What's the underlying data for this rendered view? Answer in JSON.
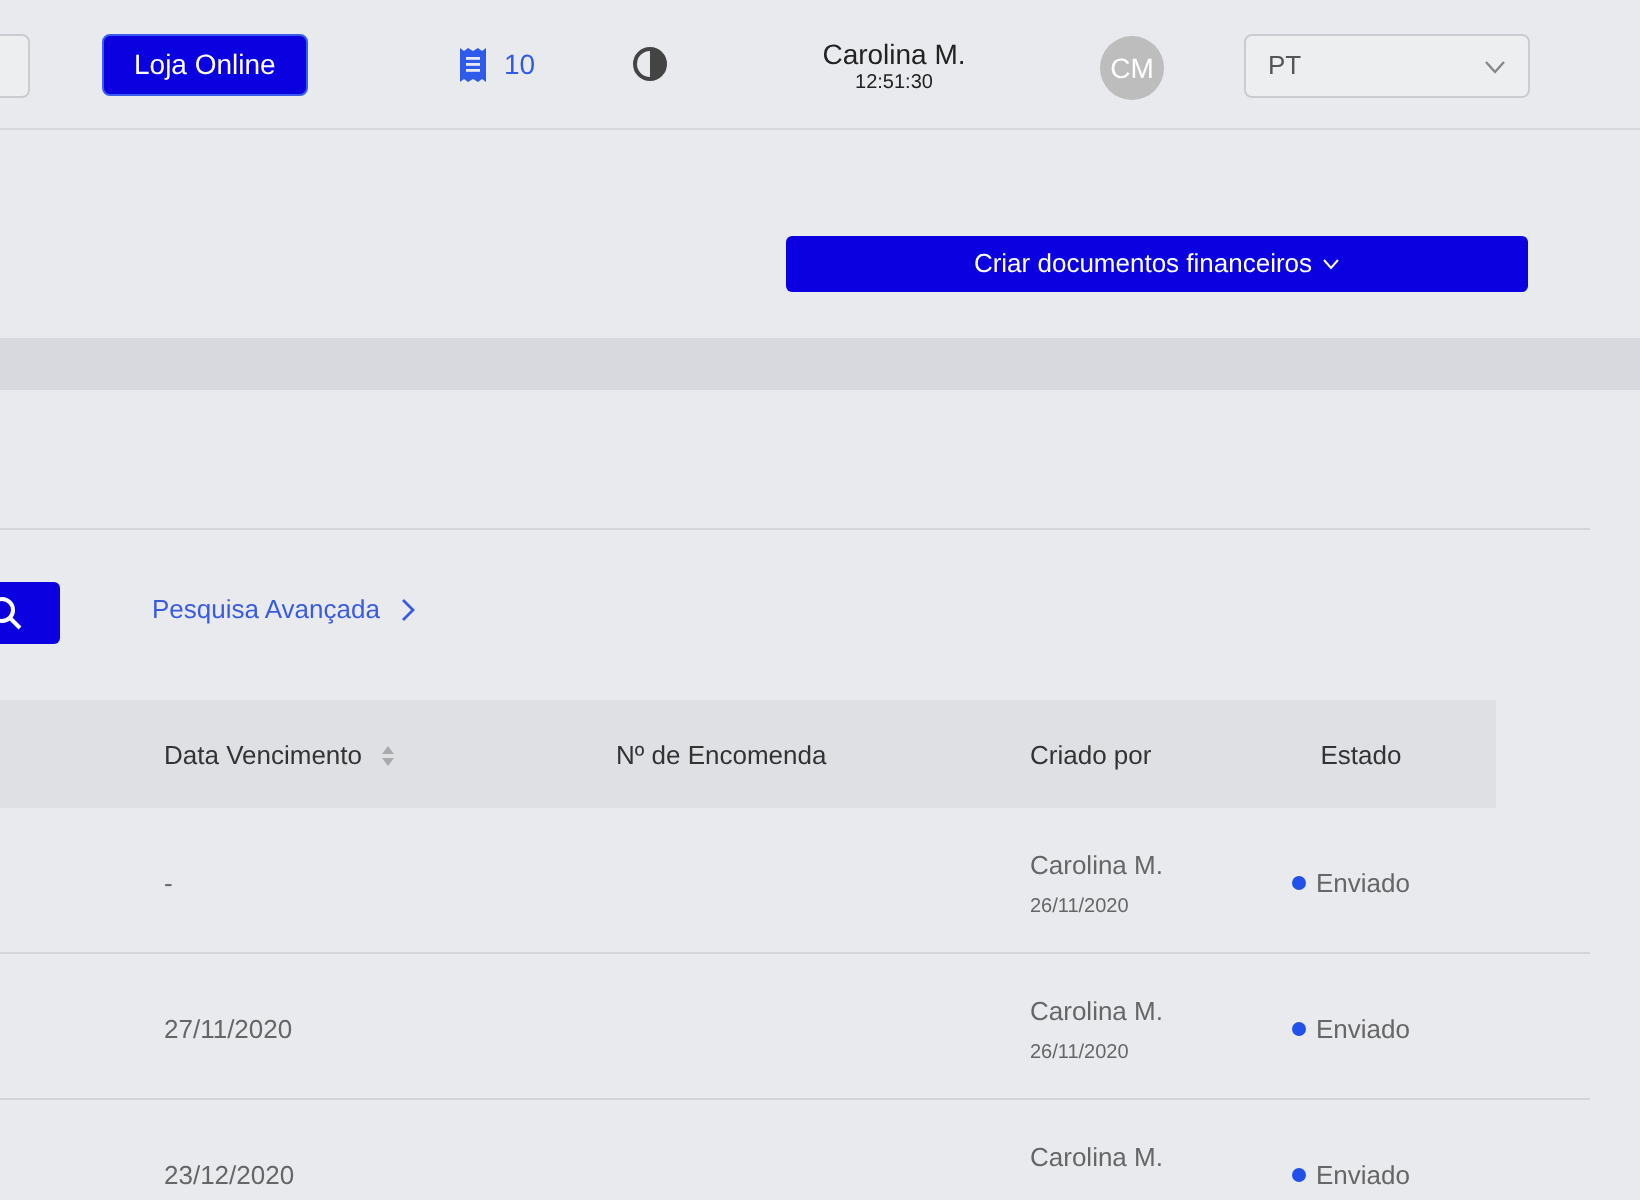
{
  "header": {
    "store_button": "Loja Online",
    "receipts_count": "10",
    "user": {
      "name": "Carolina M.",
      "time": "12:51:30",
      "initials": "CM"
    },
    "language": {
      "value": "PT"
    }
  },
  "actions": {
    "create_button": "Criar documentos financeiros"
  },
  "search": {
    "advanced_link": "Pesquisa Avançada"
  },
  "table": {
    "columns": [
      {
        "label": "Data Vencimento",
        "sortable": true
      },
      {
        "label": "Nº de Encomenda",
        "sortable": false
      },
      {
        "label": "Criado por",
        "sortable": false
      },
      {
        "label": "Estado",
        "sortable": false
      }
    ],
    "rows": [
      {
        "due_date": "-",
        "order_number": "",
        "created_by": "Carolina M.",
        "created_on": "26/11/2020",
        "status": "Enviado",
        "color": "#2250e8"
      },
      {
        "due_date": "27/11/2020",
        "order_number": "",
        "created_by": "Carolina M.",
        "created_on": "26/11/2020",
        "status": "Enviado",
        "color": "#2250e8"
      },
      {
        "due_date": "23/12/2020",
        "order_number": "",
        "created_by": "Carolina M.",
        "created_on": "",
        "status": "Enviado",
        "color": "#2250e8"
      }
    ]
  }
}
